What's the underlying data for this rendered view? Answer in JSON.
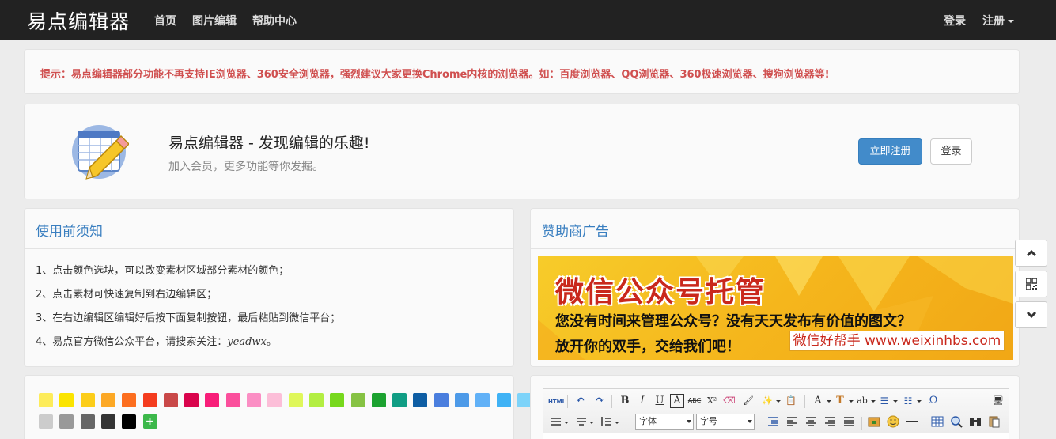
{
  "navbar": {
    "brand": "易点编辑器",
    "links": [
      "首页",
      "图片编辑",
      "帮助中心"
    ],
    "login": "登录",
    "register": "注册"
  },
  "notice": {
    "text": "提示：易点编辑器部分功能不再支持IE浏览器、360安全浏览器，强烈建议大家更换Chrome内核的浏览器。如：百度浏览器、QQ浏览器、360极速浏览器、搜狗浏览器等!"
  },
  "hero": {
    "title": "易点编辑器 - 发现编辑的乐趣!",
    "subtitle": "加入会员，更多功能等你发掘。",
    "register_button": "立即注册",
    "login_button": "登录"
  },
  "notes": {
    "title": "使用前须知",
    "items": [
      "1、点击颜色选块，可以改变素材区域部分素材的颜色；",
      "2、点击素材可快速复制到右边编辑区；",
      "3、在右边编辑区编辑好后按下面复制按钮，最后粘贴到微信平台；"
    ],
    "item4_prefix": "4、易点官方微信公众平台，请搜索关注：",
    "item4_account": "yeadwx",
    "item4_suffix": "。"
  },
  "sponsor": {
    "title": "赞助商广告",
    "ad_title": "微信公众号托管",
    "ad_line1": "您没有时间来管理公众号？没有天天发布有价值的图文？",
    "ad_line2": "放开你的双手，交给我们吧！",
    "ad_site": "微信好帮手 www.weixinhbs.com"
  },
  "colors": {
    "swatches": [
      "#fdec5a",
      "#fbe400",
      "#fccd19",
      "#fca825",
      "#fc6e1f",
      "#f43c1e",
      "#c94848",
      "#d9044c",
      "#f81e79",
      "#fb4f9c",
      "#fb8ec4",
      "#fcbed8",
      "#dff75a",
      "#b3ee42",
      "#77d81d",
      "#86c243",
      "#1ca230",
      "#109d84",
      "#0e5da3",
      "#4a7ede",
      "#4d9ae8",
      "#61b1f7",
      "#3fb2f5",
      "#7dd3f9",
      "#cccccc",
      "#999999",
      "#666666",
      "#333333",
      "#000000"
    ],
    "add_label": "+"
  },
  "editor": {
    "toolbar_row1": [
      "HTML",
      "↶",
      "↷",
      "B",
      "I",
      "U",
      "A",
      "ABC",
      "X²",
      "⌫",
      "🖌",
      "✨",
      "📋",
      "A",
      "T",
      "ab",
      "☰",
      "☷",
      "Ω",
      "🖥"
    ],
    "font_family": "字体",
    "font_size": "字号"
  },
  "float_buttons": [
    "up-icon",
    "qr-icon",
    "down-icon"
  ]
}
